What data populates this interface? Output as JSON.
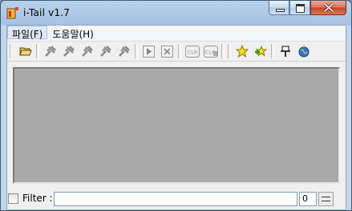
{
  "window": {
    "title": "i-Tail v1.7"
  },
  "menu": {
    "items": [
      "파일(F)",
      "도움말(H)"
    ]
  },
  "toolbar": {
    "buttons": [
      "open-folder",
      "pin-1",
      "pin-2",
      "pin-3",
      "pin-4",
      "pin-5",
      "play",
      "stop",
      "clear-1",
      "clear-2",
      "star-add",
      "star-green",
      "pin-window",
      "globe"
    ],
    "clr_label": "CLR"
  },
  "filter": {
    "label": "Filter :",
    "value": "",
    "count": "0",
    "checked": false
  },
  "colors": {
    "log_background": "#a9a9a9",
    "titlebar": "#a7c3e2"
  }
}
